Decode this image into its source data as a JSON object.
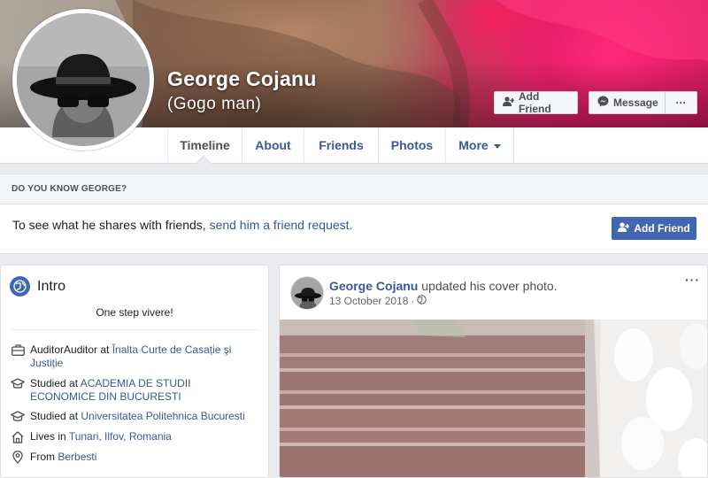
{
  "profile": {
    "name": "George Cojanu",
    "alternate_name": "(Gogo man)"
  },
  "actions": {
    "add_friend_label": "Add Friend",
    "message_label": "Message",
    "more_label": "···"
  },
  "nav": {
    "tabs": [
      {
        "label": "Timeline",
        "active": true
      },
      {
        "label": "About"
      },
      {
        "label": "Friends"
      },
      {
        "label": "Photos"
      },
      {
        "label": "More"
      }
    ]
  },
  "know_card": {
    "header": "DO YOU KNOW GEORGE?",
    "text_prefix": "To see what he shares with friends,",
    "link_text": "send him a friend request.",
    "button_label": "Add Friend"
  },
  "intro": {
    "title": "Intro",
    "bio": "One step vivere!",
    "items": [
      {
        "icon": "briefcase-icon",
        "prefix": "AuditorAuditor at ",
        "link": "Înalta Curte de Casație şi Justiție"
      },
      {
        "icon": "graduation-cap-icon",
        "prefix": "Studied at ",
        "link": "ACADEMIA DE STUDII ECONOMICE DIN BUCURESTI"
      },
      {
        "icon": "graduation-cap-icon",
        "prefix": "Studied at ",
        "link": "Universitatea Politehnica Bucuresti"
      },
      {
        "icon": "home-icon",
        "prefix": "Lives in ",
        "link": "Tunari, Ilfov, Romania"
      },
      {
        "icon": "location-pin-icon",
        "prefix": "From ",
        "link": "Berbesti"
      }
    ]
  },
  "post": {
    "author": "George Cojanu",
    "action": "updated his cover photo.",
    "date": "13 October 2018",
    "separator": "·",
    "privacy_icon": "globe-icon",
    "more_label": "···"
  },
  "colors": {
    "link": "#385898",
    "primary_button": "#4267b2",
    "page_background": "#e9ebee"
  }
}
